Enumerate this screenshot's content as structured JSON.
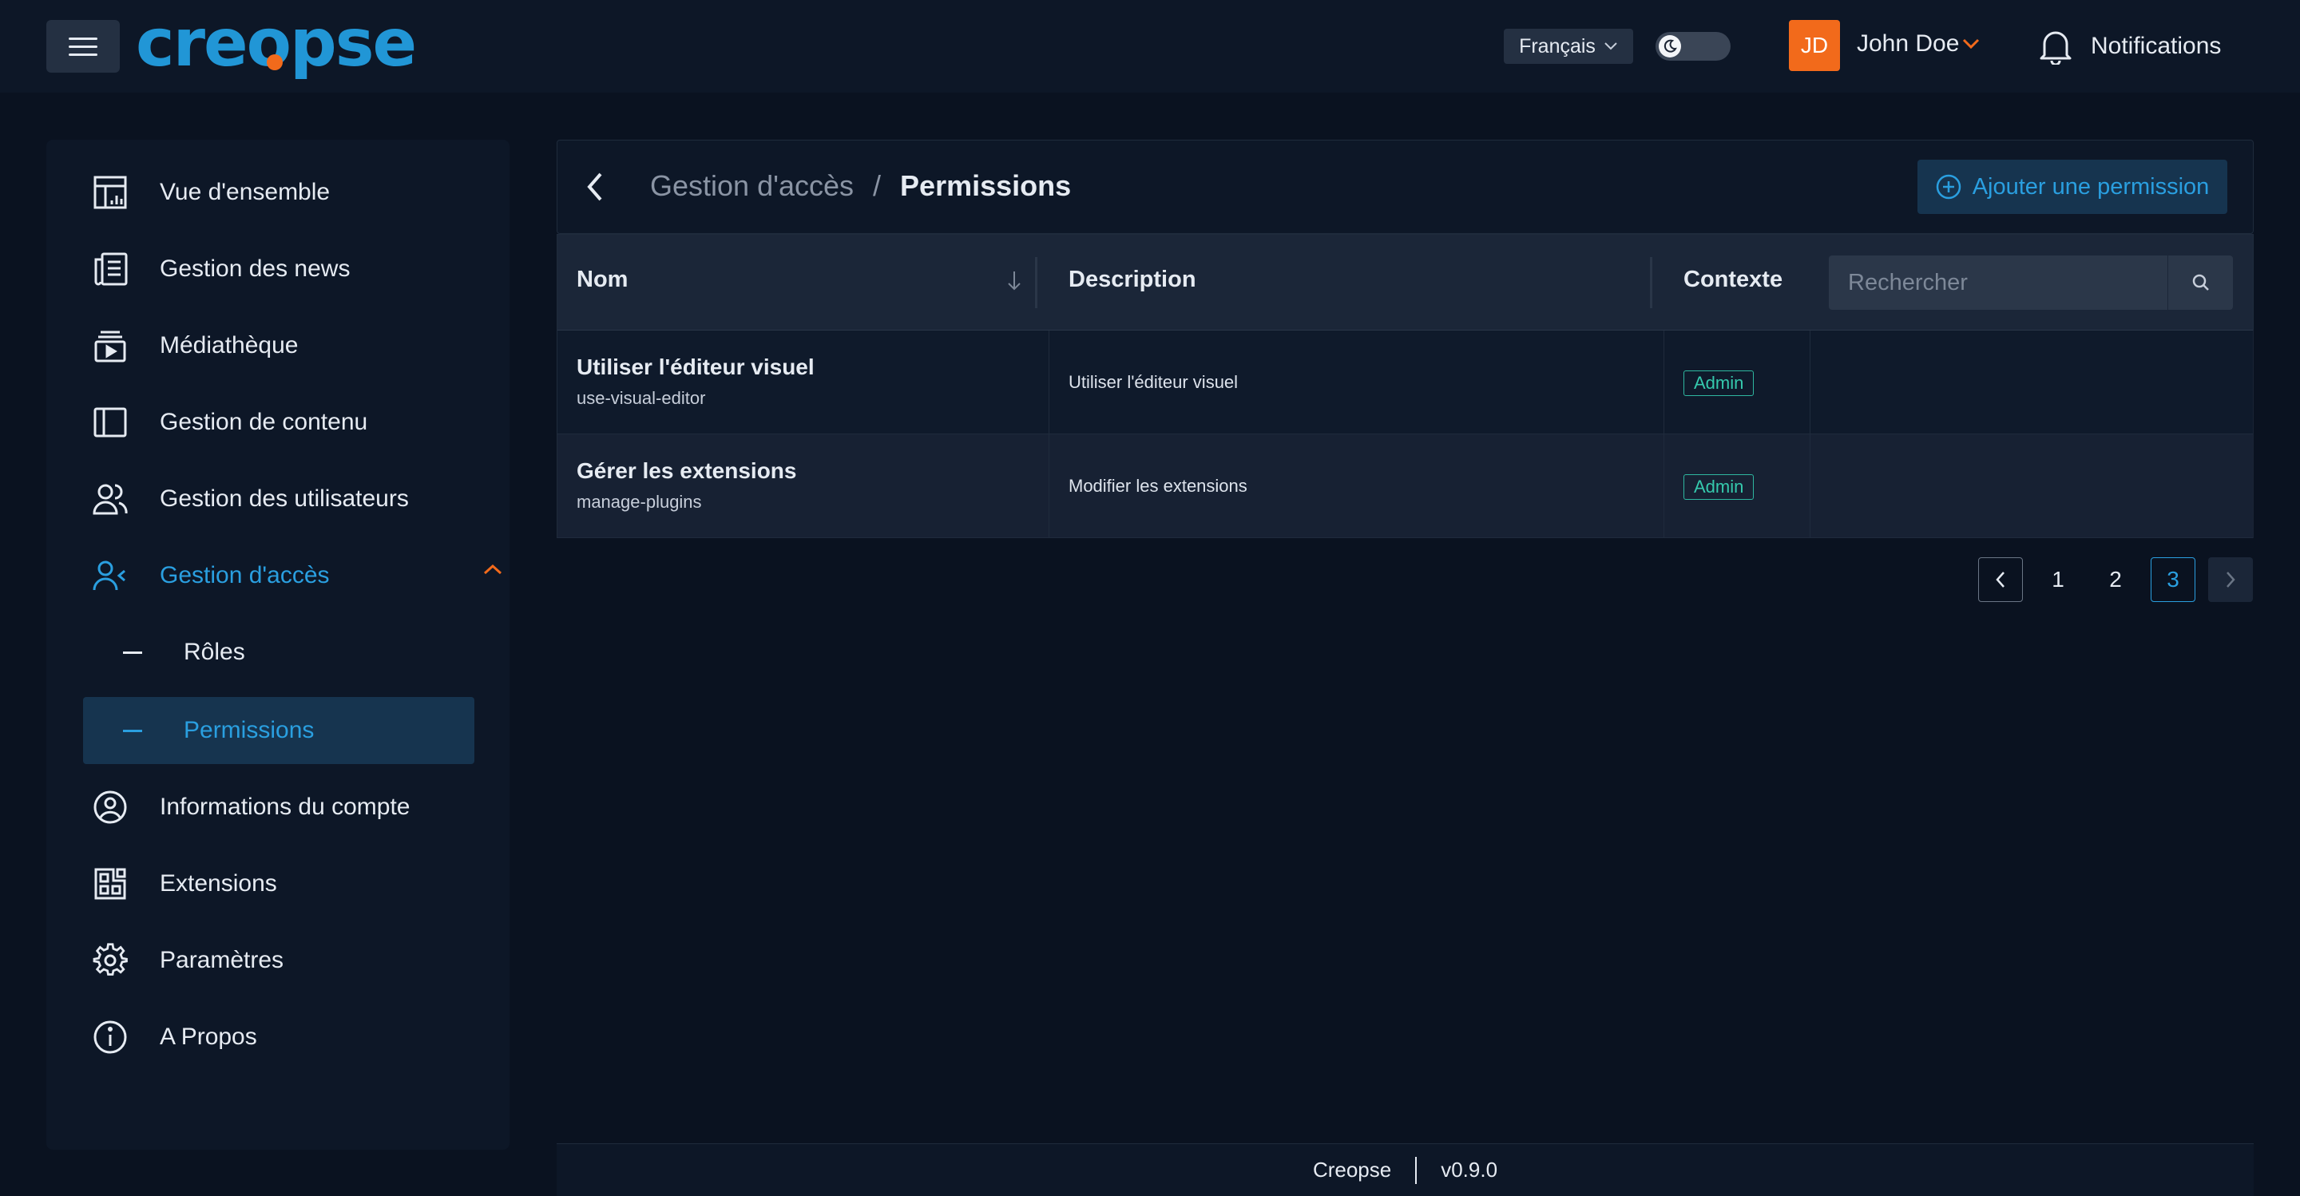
{
  "header": {
    "logo": "creopse",
    "language": "Français",
    "user_initials": "JD",
    "user_name": "John Doe",
    "notifications_label": "Notifications",
    "menu_icon": "hamburger-icon",
    "theme_toggle_icon": "moon-icon"
  },
  "sidebar": {
    "items": [
      {
        "label": "Vue d'ensemble",
        "icon": "dashboard-icon"
      },
      {
        "label": "Gestion des news",
        "icon": "newspaper-icon"
      },
      {
        "label": "Médiathèque",
        "icon": "media-library-icon"
      },
      {
        "label": "Gestion de contenu",
        "icon": "layout-icon"
      },
      {
        "label": "Gestion des utilisateurs",
        "icon": "users-icon"
      },
      {
        "label": "Gestion d'accès",
        "icon": "access-icon"
      },
      {
        "label": "Informations du compte",
        "icon": "account-icon"
      },
      {
        "label": "Extensions",
        "icon": "extensions-icon"
      },
      {
        "label": "Paramètres",
        "icon": "gear-icon"
      },
      {
        "label": "A Propos",
        "icon": "info-icon"
      }
    ],
    "sub_items": [
      {
        "label": "Rôles"
      },
      {
        "label": "Permissions"
      }
    ]
  },
  "page": {
    "breadcrumb_parent": "Gestion d'accès",
    "breadcrumb_separator": "/",
    "breadcrumb_current": "Permissions",
    "add_button_label": "Ajouter une permission"
  },
  "table": {
    "columns": [
      "Nom",
      "Description",
      "Contexte"
    ],
    "search_placeholder": "Rechercher",
    "rows": [
      {
        "name": "Utiliser l'éditeur visuel",
        "key": "use-visual-editor",
        "description": "Utiliser l'éditeur visuel",
        "context": "Admin"
      },
      {
        "name": "Gérer les extensions",
        "key": "manage-plugins",
        "description": "Modifier les extensions",
        "context": "Admin"
      }
    ]
  },
  "pagination": {
    "pages": [
      "1",
      "2",
      "3"
    ],
    "current": "3"
  },
  "footer": {
    "app_name": "Creopse",
    "version": "v0.9.0"
  },
  "colors": {
    "accent": "#2a9fe0",
    "brand_orange": "#f26a1b",
    "badge": "#35c9ad",
    "background": "#0a1220"
  }
}
